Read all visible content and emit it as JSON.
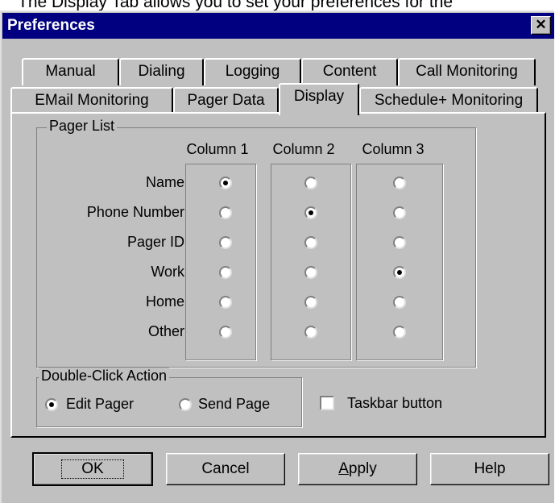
{
  "caption": "The Display Tab allows you to set your preferences for the",
  "dialog": {
    "title": "Preferences",
    "close_glyph": "✕"
  },
  "tabs_back": [
    "Manual",
    "Dialing",
    "Logging",
    "Content",
    "Call Monitoring"
  ],
  "tabs_front": [
    "EMail Monitoring",
    "Pager Data",
    "Display",
    "Schedule+ Monitoring"
  ],
  "active_tab": "Display",
  "pager_list": {
    "legend": "Pager List",
    "columns": [
      "Column 1",
      "Column 2",
      "Column 3"
    ],
    "rows": [
      "Name",
      "Phone Number",
      "Pager ID",
      "Work",
      "Home",
      "Other"
    ],
    "selected": {
      "Column 1": "Name",
      "Column 2": "Phone Number",
      "Column 3": "Work"
    }
  },
  "double_click": {
    "legend": "Double-Click Action",
    "options": [
      "Edit Pager",
      "Send Page"
    ],
    "selected": "Edit Pager"
  },
  "taskbar": {
    "label": "Taskbar button",
    "checked": false
  },
  "buttons": {
    "ok": "OK",
    "cancel": "Cancel",
    "apply_pre": "",
    "apply_key": "A",
    "apply_post": "pply",
    "help": "Help"
  }
}
